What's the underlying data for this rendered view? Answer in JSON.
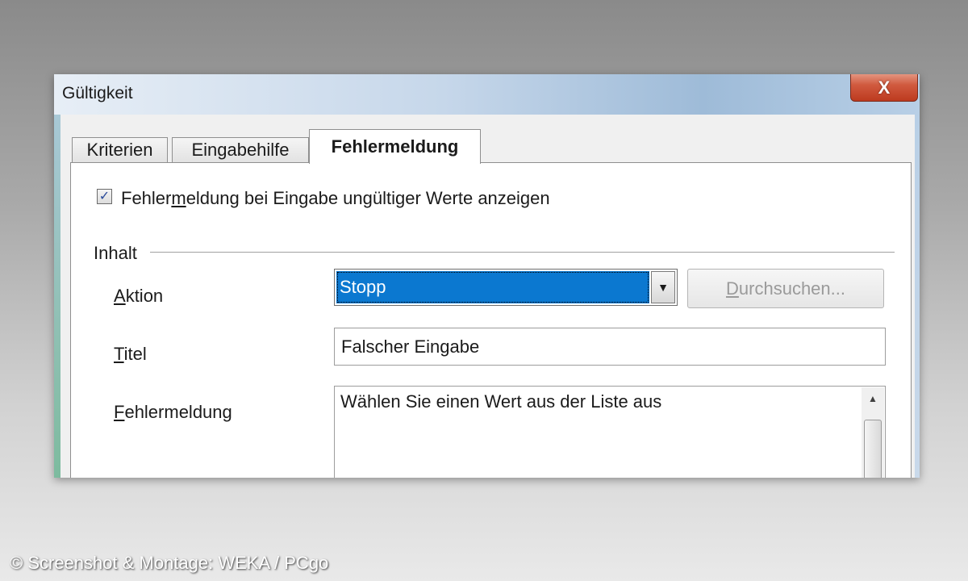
{
  "window": {
    "title": "Gültigkeit",
    "close_glyph": "X"
  },
  "tabs": [
    {
      "label": "Kriterien",
      "active": false
    },
    {
      "label": "Eingabehilfe",
      "active": false
    },
    {
      "label": "Fehlermeldung",
      "active": true
    }
  ],
  "checkbox": {
    "checked": true,
    "label_before": "Fehler",
    "label_mnemonic": "m",
    "label_after": "eldung bei Eingabe ungültiger Werte anzeigen"
  },
  "group": {
    "label": "Inhalt"
  },
  "fields": {
    "action": {
      "label_mnemonic": "A",
      "label_rest": "ktion",
      "value": "Stopp"
    },
    "browse": {
      "label_mnemonic": "D",
      "label_rest": "urchsuchen..."
    },
    "title": {
      "label_mnemonic": "T",
      "label_rest": "itel",
      "value": "Falscher Eingabe"
    },
    "message": {
      "label_mnemonic": "F",
      "label_rest": "ehlermeldung",
      "value": "Wählen Sie einen Wert aus der Liste aus"
    }
  },
  "footer": {
    "copyright": "© Screenshot & Montage: WEKA / PCgo"
  },
  "colors": {
    "selection": "#0b78d0",
    "close_button": "#c9472b"
  }
}
